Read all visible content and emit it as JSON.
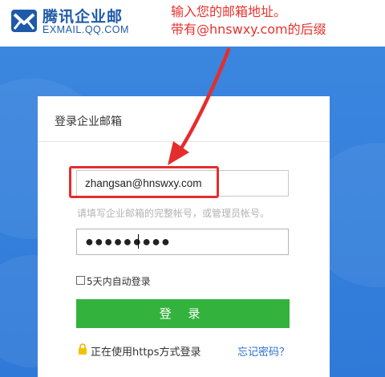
{
  "header": {
    "brand_name": "腾讯企业邮",
    "brand_domain": "EXMAIL.QQ.COM",
    "brand_color": "#1f5aa8"
  },
  "annotation": {
    "line1": "输入您的邮箱地址。",
    "line2": "带有@hnswxy.com的后缀",
    "color": "#e8322c"
  },
  "login_card": {
    "title": "登录企业邮箱",
    "email_value": "zhangsan@hnswxy.com",
    "email_hint": "请填写企业邮箱的完整帐号，或管理员帐号。",
    "password_value": "●●●●●●●●●",
    "remember_label": "5天内自动登录",
    "login_button_label": "登 录",
    "https_text": "正在使用https方式登录",
    "forgot_password_label": "忘记密码？",
    "button_color": "#34b23e",
    "link_color": "#2a6fd0"
  },
  "icons": {
    "logo": "mail-logo-icon",
    "lock": "lock-icon",
    "arrow": "red-arrow-icon"
  }
}
